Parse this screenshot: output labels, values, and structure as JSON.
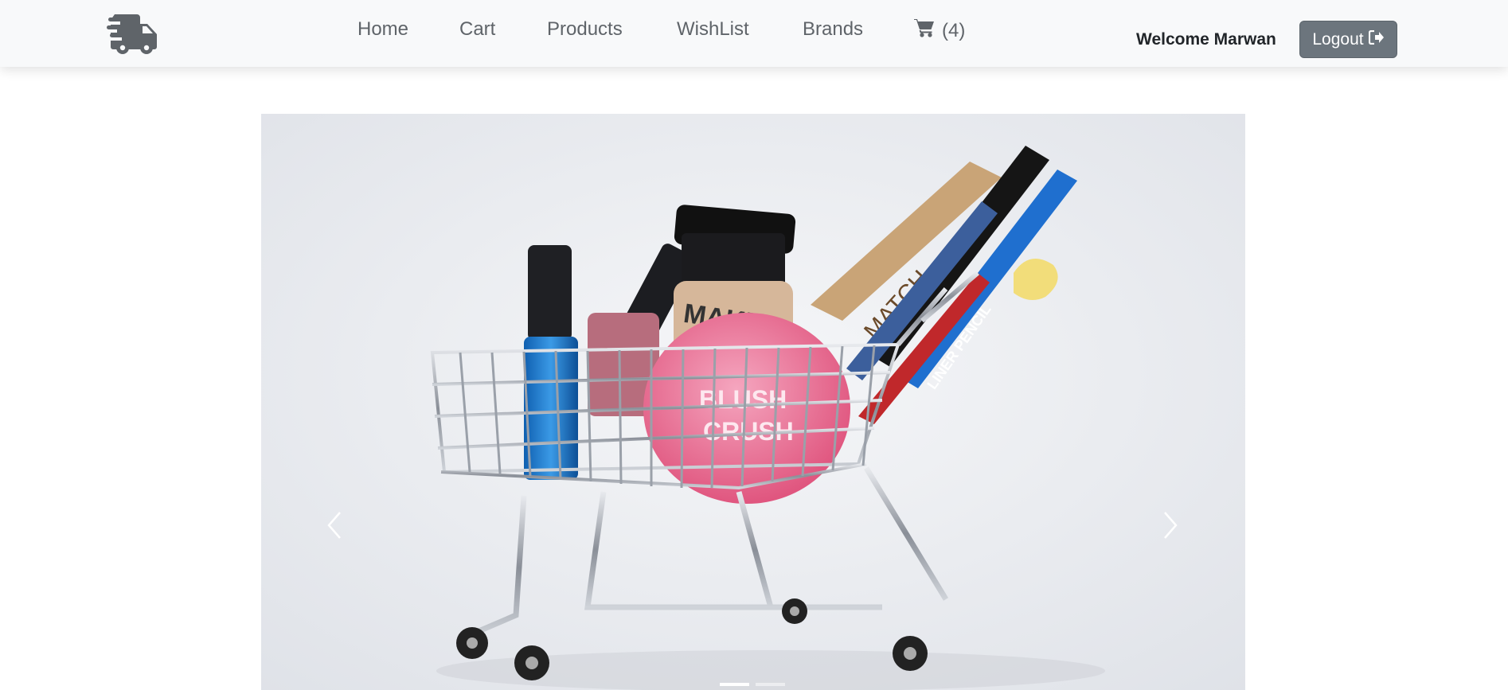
{
  "brand": {
    "logo_icon": "shipping-truck-icon"
  },
  "nav": {
    "home": "Home",
    "cart": "Cart",
    "products": "Products",
    "wishlist": "WishList",
    "brands": "Brands",
    "cart_count": "(4)",
    "cart_icon": "shopping-cart-icon"
  },
  "user": {
    "welcome": "Welcome Marwan",
    "logout_label": "Logout",
    "logout_icon": "sign-out-icon"
  },
  "carousel": {
    "slide_image": "shopping-cart-with-makeup-products",
    "prev_icon": "chevron-left-icon",
    "next_icon": "chevron-right-icon",
    "slide_count": 2,
    "active_index": 0
  },
  "colors": {
    "navbar_bg": "#f8f9fa",
    "nav_link": "#5f6469",
    "logout_bg": "#6c757d"
  }
}
